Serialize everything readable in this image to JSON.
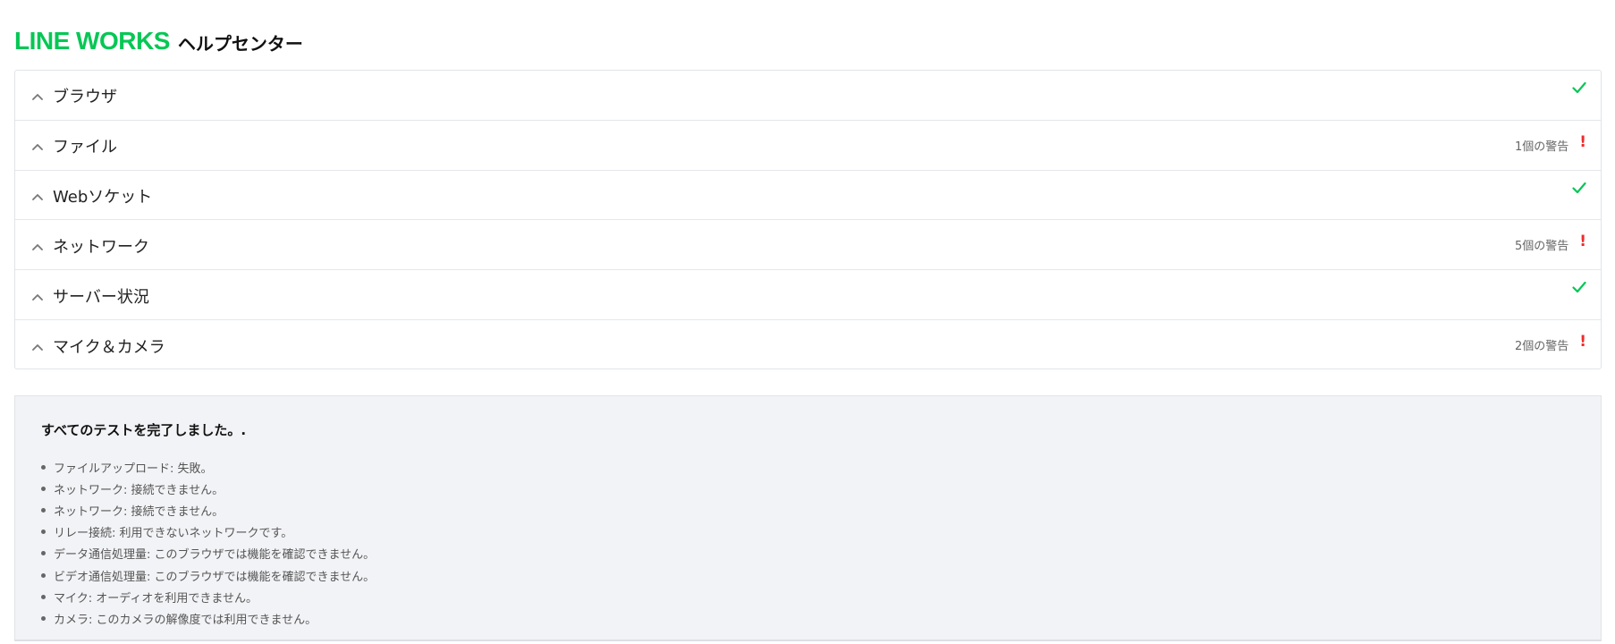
{
  "header": {
    "logo_text": "LINE WORKS",
    "title": "ヘルプセンター"
  },
  "colors": {
    "brand": "#06c755",
    "ok": "#06c755",
    "warning": "#ee2b2b",
    "summary_bg": "#f2f3f6"
  },
  "tests": [
    {
      "label": "ブラウザ",
      "status": "ok",
      "warning_text": "",
      "icon": "check-icon"
    },
    {
      "label": "ファイル",
      "status": "warning",
      "warning_text": "1個の警告",
      "icon": "exclamation-icon"
    },
    {
      "label": "Webソケット",
      "status": "ok",
      "warning_text": "",
      "icon": "check-icon"
    },
    {
      "label": "ネットワーク",
      "status": "warning",
      "warning_text": "5個の警告",
      "icon": "exclamation-icon"
    },
    {
      "label": "サーバー状況",
      "status": "ok",
      "warning_text": "",
      "icon": "check-icon"
    },
    {
      "label": "マイク＆カメラ",
      "status": "warning",
      "warning_text": "2個の警告",
      "icon": "exclamation-icon"
    }
  ],
  "summary": {
    "title": "すべてのテストを完了しました。.",
    "items": [
      "ファイルアップロード: 失敗。",
      "ネットワーク: 接続できません。",
      "ネットワーク: 接続できません。",
      "リレー接続: 利用できないネットワークです。",
      "データ通信処理量: このブラウザでは機能を確認できません。",
      "ビデオ通信処理量: このブラウザでは機能を確認できません。",
      "マイク: オーディオを利用できません。",
      "カメラ: このカメラの解像度では利用できません。"
    ]
  }
}
